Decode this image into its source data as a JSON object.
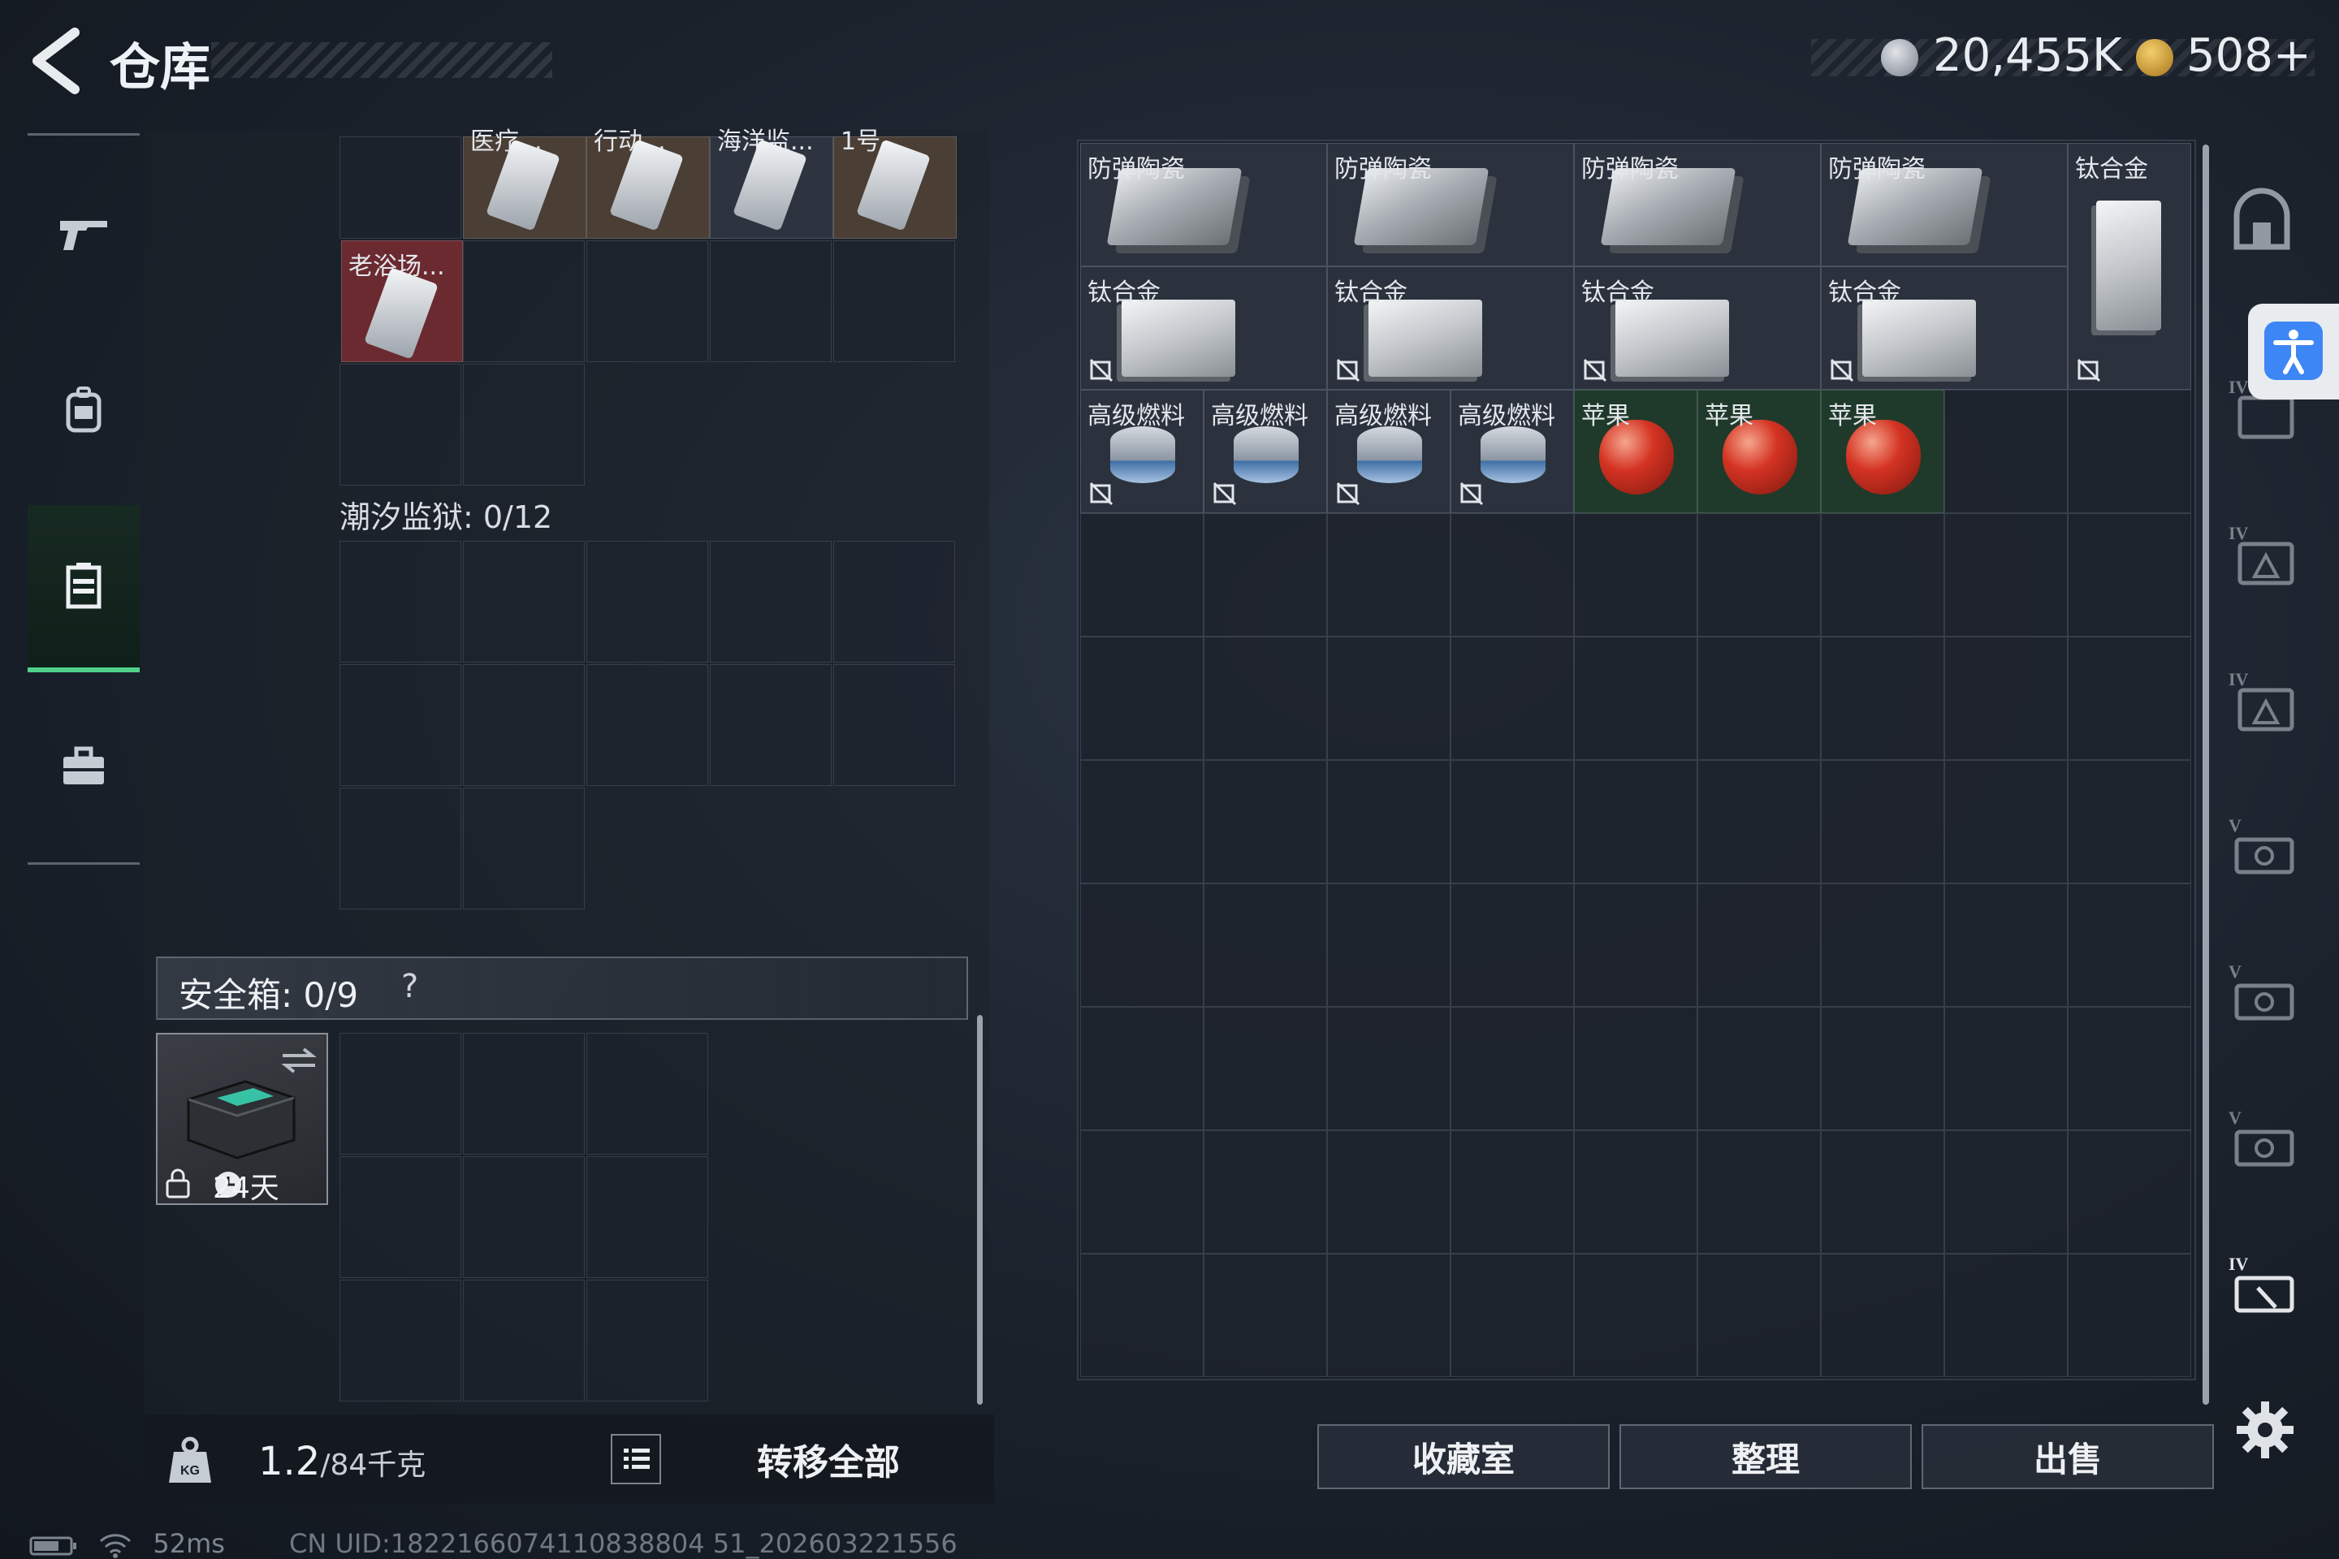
{
  "header": {
    "back_icon": "chevron-left-icon",
    "title": "仓库",
    "currency_silver": "20,455K",
    "currency_gold": "508+",
    "colors": {
      "accent_green": "#4fd18b",
      "gold": "#d9a53a",
      "silver": "#b8bdc4"
    }
  },
  "rail": {
    "items": [
      {
        "icon": "gun-icon",
        "active": false
      },
      {
        "icon": "backpack-icon",
        "active": false
      },
      {
        "icon": "storage-icon",
        "active": true
      },
      {
        "icon": "toolbox-icon",
        "active": false
      }
    ]
  },
  "left_panel": {
    "top_item_labels": [
      "医疗...",
      "行动...",
      "海洋监...",
      "1号..."
    ],
    "item_card_label": "老浴场...",
    "section_label": "潮汐监狱: 0/12",
    "safe_box_label": "安全箱: 0/9",
    "safe_box_help": "?",
    "safe_box_timer": "24天"
  },
  "footer": {
    "weight_value": "1.2",
    "weight_unit": "/84千克",
    "transfer_all": "转移全部",
    "ping": "52ms",
    "uid": "CN UID:1822166074110838804 51_202603221556"
  },
  "storage": {
    "items": [
      {
        "label": "防弹陶瓷",
        "kind": "ceramic"
      },
      {
        "label": "防弹陶瓷",
        "kind": "ceramic"
      },
      {
        "label": "防弹陶瓷",
        "kind": "ceramic"
      },
      {
        "label": "防弹陶瓷",
        "kind": "ceramic"
      },
      {
        "label": "钛合金",
        "kind": "titan-tall"
      },
      {
        "label": "钛合金",
        "kind": "titan"
      },
      {
        "label": "钛合金",
        "kind": "titan"
      },
      {
        "label": "钛合金",
        "kind": "titan"
      },
      {
        "label": "钛合金",
        "kind": "titan"
      },
      {
        "label": "高级燃料",
        "kind": "fuel"
      },
      {
        "label": "高级燃料",
        "kind": "fuel"
      },
      {
        "label": "高级燃料",
        "kind": "fuel"
      },
      {
        "label": "高级燃料",
        "kind": "fuel"
      },
      {
        "label": "苹果",
        "kind": "apple"
      },
      {
        "label": "苹果",
        "kind": "apple"
      },
      {
        "label": "苹果",
        "kind": "apple"
      }
    ]
  },
  "buttons": {
    "collection": "收藏室",
    "sort": "整理",
    "sell": "出售"
  },
  "side_icons": [
    "bag-icon",
    "case-iv-icon",
    "case-iv-icon",
    "case-iv-icon",
    "case-v-icon",
    "case-v-icon",
    "case-v-icon",
    "case-iv-icon",
    "settings-icon",
    "accessibility-icon"
  ]
}
